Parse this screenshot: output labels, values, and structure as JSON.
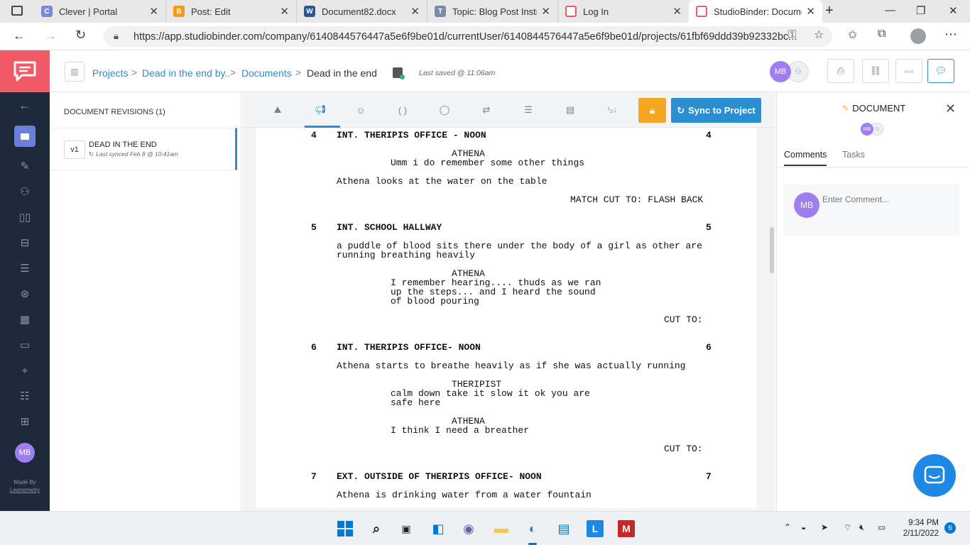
{
  "browser": {
    "tabs": [
      {
        "title": "Clever | Portal"
      },
      {
        "title": "Post: Edit"
      },
      {
        "title": "Document82.docx"
      },
      {
        "title": "Topic: Blog Post Instru"
      },
      {
        "title": "Log In"
      },
      {
        "title": "StudioBinder: Docume"
      }
    ],
    "url": "https://app.studiobinder.com/company/6140844576447a5e6f9be01d/currentUser/6140844576447a5e6f9be01d/projects/61fbf69ddd39b92332bc..."
  },
  "header": {
    "breadcrumb": [
      "Projects",
      "Dead in the end by..",
      "Documents",
      "Dead in the end"
    ],
    "last_saved": "Last saved @ 11:06am",
    "avatar_initials": "MB"
  },
  "revisions": {
    "title": "DOCUMENT REVISIONS (1)",
    "items": [
      {
        "version": "v1",
        "name": "DEAD IN THE END",
        "synced": "Last synced Feb 8 @ 10:41am"
      }
    ]
  },
  "toolbar": {
    "sync_label": "Sync to Project"
  },
  "script": {
    "lines": [
      {
        "type": "scene",
        "num": "4",
        "text": "INT. THERIPIS OFFICE - NOON"
      },
      {
        "type": "character",
        "text": "ATHENA"
      },
      {
        "type": "dialogue",
        "text": "Umm i do remember some other things"
      },
      {
        "type": "action",
        "text": "Athena looks at the water on the table"
      },
      {
        "type": "transition",
        "text": "MATCH CUT TO: FLASH BACK"
      },
      {
        "type": "scene",
        "num": "5",
        "text": "INT. SCHOOL HALLWAY"
      },
      {
        "type": "action",
        "text": "a puddle of blood sits there under the body of a girl as other are"
      },
      {
        "type": "action",
        "text": "running breathing heavily"
      },
      {
        "type": "character",
        "text": "ATHENA"
      },
      {
        "type": "dialogue",
        "text": "I remember hearing.... thuds as we ran"
      },
      {
        "type": "dialogue",
        "text": "up the steps... and I heard the sound"
      },
      {
        "type": "dialogue",
        "text": "of blood pouring"
      },
      {
        "type": "transition",
        "text": "CUT TO:"
      },
      {
        "type": "scene",
        "num": "6",
        "text": "INT. THERIPIS OFFICE- NOON"
      },
      {
        "type": "action",
        "text": "Athena starts to breathe heavily as if she was actually running"
      },
      {
        "type": "character",
        "text": "THERIPIST"
      },
      {
        "type": "dialogue",
        "text": "calm down take it slow it ok you are"
      },
      {
        "type": "dialogue",
        "text": "safe here"
      },
      {
        "type": "character",
        "text": "ATHENA"
      },
      {
        "type": "dialogue",
        "text": "I think I need a breather"
      },
      {
        "type": "transition",
        "text": "CUT TO:"
      },
      {
        "type": "scene",
        "num": "7",
        "text": "EXT. OUTSIDE OF THERIPIS OFFICE- NOON"
      },
      {
        "type": "action",
        "text": "Athena is drinking water from a water fountain"
      }
    ]
  },
  "right_panel": {
    "title": "DOCUMENT",
    "tabs": [
      "Comments",
      "Tasks"
    ],
    "active_tab": "Comments",
    "comment_placeholder": "Enter Comment...",
    "avatar_initials": "MB"
  },
  "sidebar": {
    "made_by": "Made By",
    "made_by_name": "Leanometry",
    "avatar_initials": "MB"
  },
  "taskbar": {
    "time": "9:34 PM",
    "date": "2/11/2022",
    "notification_count": "6"
  },
  "colors": {
    "brand": "#f25966",
    "link": "#2a8ed0",
    "sync_button": "#2a8ed0",
    "lock_button": "#f5a623",
    "sidebar": "#1e2a3a",
    "avatar": "#a07ef0"
  }
}
